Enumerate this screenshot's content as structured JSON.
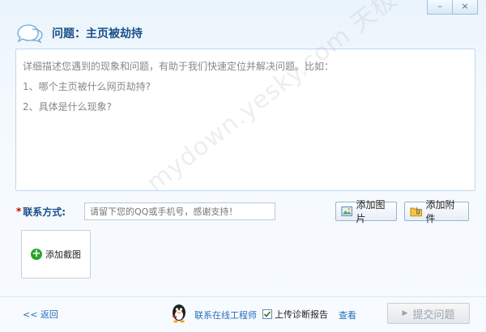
{
  "window": {
    "minimize_label": "–",
    "close_label": "×"
  },
  "header": {
    "title": "问题：主页被劫持"
  },
  "description": {
    "lines": [
      "详细描述您遇到的现象和问题，有助于我们快速定位并解决问题。比如：",
      "1、哪个主页被什么网页劫持?",
      "2、具体是什么现象?"
    ]
  },
  "contact": {
    "required_mark": "*",
    "label": "联系方式:",
    "placeholder": "请留下您的QQ或手机号，感谢支持！"
  },
  "buttons": {
    "add_image": "添加图片",
    "add_attachment": "添加附件",
    "add_screenshot": "添加截图",
    "add_screenshot_plus": "+"
  },
  "footer": {
    "back": "<< 返回",
    "contact_engineer": "联系在线工程师",
    "upload_report": "上传诊断报告",
    "upload_checked": true,
    "view": "查看",
    "submit": "提交问题",
    "submit_arrow": "▶"
  },
  "watermark": "mydown.yesky.com 天极下载站",
  "colors": {
    "accent": "#1a4f8a",
    "link": "#2a6fb8",
    "required": "#d40000",
    "success": "#2aa52a"
  }
}
